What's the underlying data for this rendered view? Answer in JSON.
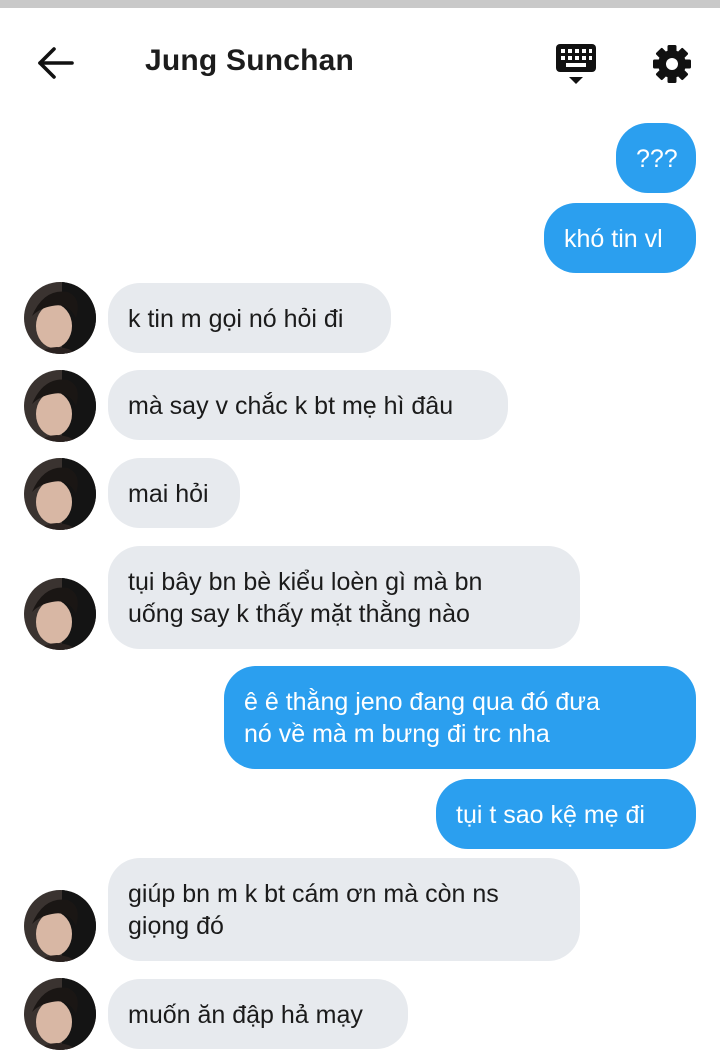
{
  "header": {
    "title": "Jung Sunchan",
    "back_icon": "arrow-left-icon",
    "keyboard_icon": "keyboard-icon",
    "settings_icon": "gear-icon"
  },
  "colors": {
    "outgoing_bubble": "#2b9fef",
    "incoming_bubble": "#e7eaee",
    "title_text": "#1c1c1c"
  },
  "messages": [
    {
      "direction": "out",
      "text": "???"
    },
    {
      "direction": "out",
      "text": "khó tin vl"
    },
    {
      "direction": "in",
      "text": "k tin m gọi nó hỏi đi"
    },
    {
      "direction": "in",
      "text": "mà say v chắc k bt mẹ hì đâu"
    },
    {
      "direction": "in",
      "text": "mai hỏi"
    },
    {
      "direction": "in",
      "text": "tụi bây bn bè kiểu loèn gì mà bn\nuống say k thấy mặt thằng nào"
    },
    {
      "direction": "out",
      "text": "ê ê thằng jeno đang qua đó đưa\nnó về mà m bưng đi trc nha"
    },
    {
      "direction": "out",
      "text": "tụi t sao kệ mẹ đi"
    },
    {
      "direction": "in",
      "text": "giúp bn m k bt cám ơn mà còn ns\ngiọng đó"
    },
    {
      "direction": "in",
      "text": "muốn ăn đập hả mạy"
    }
  ]
}
